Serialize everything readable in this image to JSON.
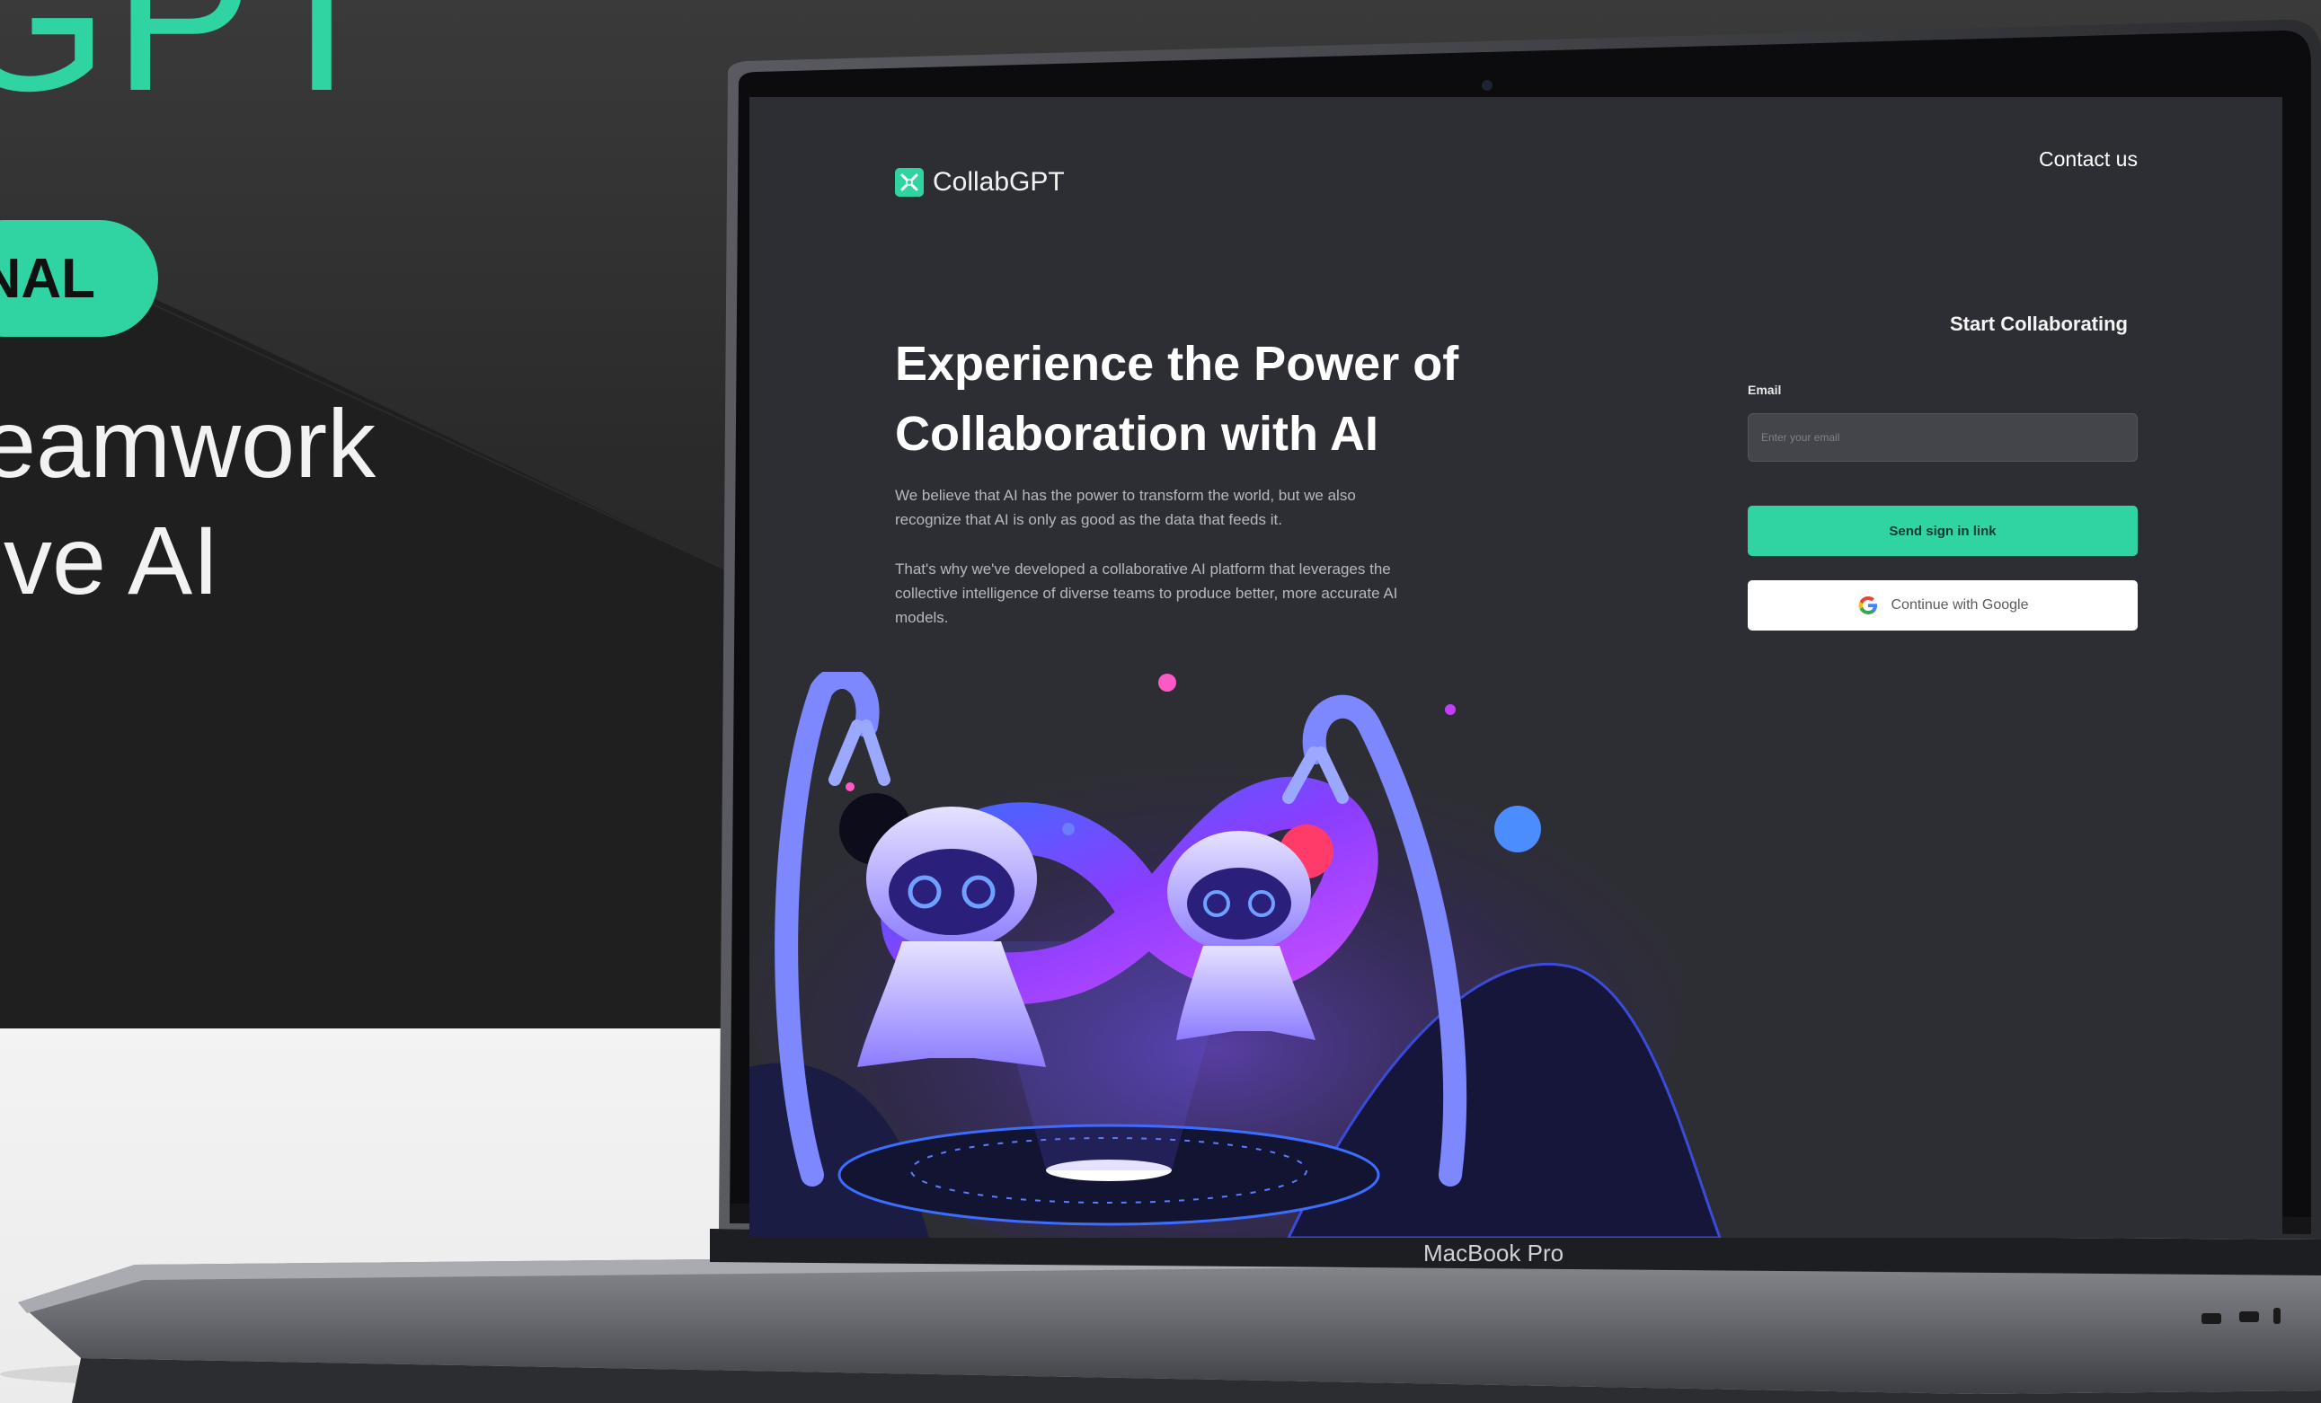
{
  "promo": {
    "logo_fragment": "GPT",
    "badge_fragment": "NAL",
    "headline_line1": "eamwork",
    "headline_line2": "ive AI"
  },
  "screen": {
    "brand": {
      "name": "CollabGPT",
      "icon": "collab-logo-icon"
    },
    "nav": {
      "contact": "Contact us"
    },
    "hero": {
      "title": "Experience the Power of Collaboration with AI",
      "paragraph1": "We believe that AI has the power to transform the world, but we also recognize that AI is only as good as the data that feeds it.",
      "paragraph2": "That's why we've developed a collaborative AI platform that leverages the collective intelligence of diverse teams to produce better, more accurate AI models."
    },
    "form": {
      "title": "Start Collaborating",
      "email_label": "Email",
      "email_value": "",
      "email_placeholder": "Enter your email",
      "send_link_label": "Send sign in link",
      "google_label": "Continue with Google"
    }
  },
  "device": {
    "model_label": "MacBook Pro"
  },
  "colors": {
    "accent": "#2fd4a2",
    "screen_bg": "#2d2e33",
    "input_bg": "#44454b",
    "illustration_purple": "#7a4cff",
    "illustration_blue": "#3b6dff"
  }
}
